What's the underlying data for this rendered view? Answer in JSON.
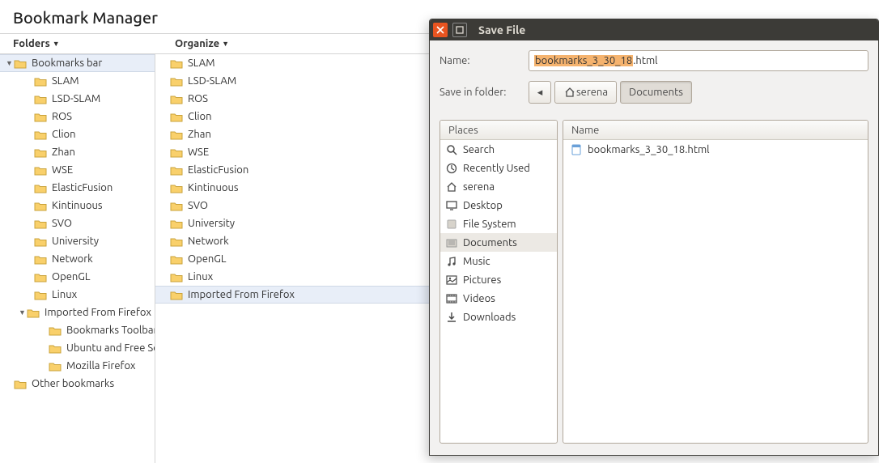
{
  "page_title": "Bookmark Manager",
  "toolbar": {
    "folders": "Folders",
    "organize": "Organize"
  },
  "tree": {
    "bookmarks_bar": "Bookmarks bar",
    "items": [
      "SLAM",
      "LSD-SLAM",
      "ROS",
      "Clion",
      "Zhan",
      "WSE",
      "ElasticFusion",
      "Kintinuous",
      "SVO",
      "University",
      "Network",
      "OpenGL",
      "Linux"
    ],
    "imported": "Imported From Firefox",
    "imported_children": [
      "Bookmarks Toolbar",
      "Ubuntu and Free Soft",
      "Mozilla Firefox"
    ],
    "other": "Other bookmarks"
  },
  "list": {
    "items": [
      "SLAM",
      "LSD-SLAM",
      "ROS",
      "Clion",
      "Zhan",
      "WSE",
      "ElasticFusion",
      "Kintinuous",
      "SVO",
      "University",
      "Network",
      "OpenGL",
      "Linux",
      "Imported From Firefox"
    ]
  },
  "dialog": {
    "title": "Save File",
    "name_label": "Name:",
    "save_in_label": "Save in folder:",
    "filename_sel": "bookmarks_3_30_18",
    "filename_ext": ".html",
    "path": {
      "back": "◂",
      "home": "serena",
      "current": "Documents"
    },
    "places_header": "Places",
    "files_header": "Name",
    "places": [
      {
        "icon": "search",
        "label": "Search"
      },
      {
        "icon": "clock",
        "label": "Recently Used"
      },
      {
        "icon": "home",
        "label": "serena"
      },
      {
        "icon": "desktop",
        "label": "Desktop"
      },
      {
        "icon": "disk",
        "label": "File System"
      },
      {
        "icon": "folder",
        "label": "Documents",
        "selected": true
      },
      {
        "icon": "music",
        "label": "Music"
      },
      {
        "icon": "pictures",
        "label": "Pictures"
      },
      {
        "icon": "video",
        "label": "Videos"
      },
      {
        "icon": "download",
        "label": "Downloads"
      }
    ],
    "files": [
      {
        "icon": "html",
        "label": "bookmarks_3_30_18.html"
      }
    ]
  }
}
